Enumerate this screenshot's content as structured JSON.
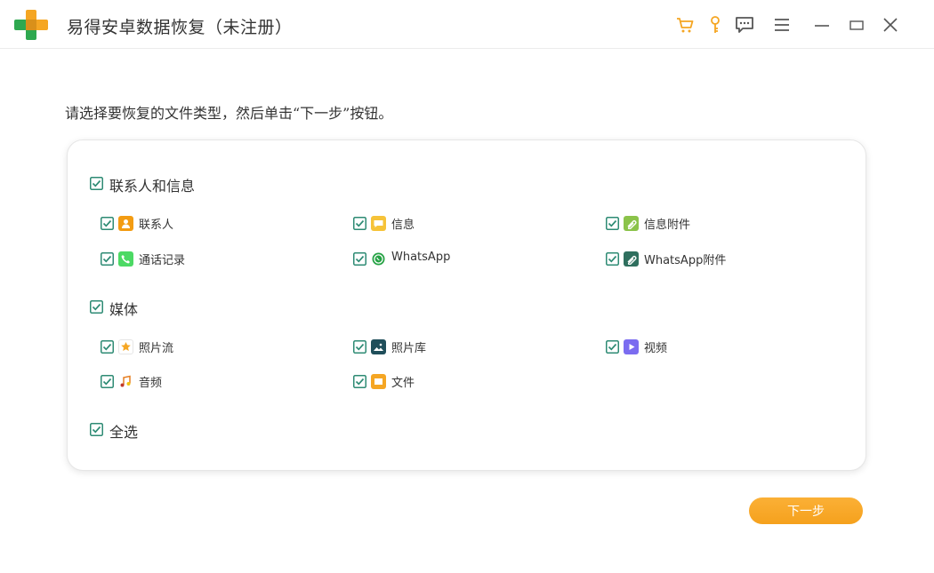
{
  "titlebar": {
    "title": "易得安卓数据恢复（未注册）",
    "icons": [
      "cart-icon",
      "key-icon",
      "feedback-icon",
      "menu-icon",
      "minimize-icon",
      "maximize-icon",
      "close-icon"
    ]
  },
  "instruction": "请选择要恢复的文件类型，然后单击“下一步”按钮。",
  "groups": [
    {
      "label": "联系人和信息",
      "checked": true,
      "items": [
        {
          "label": "联系人",
          "icon": "contacts-icon",
          "checked": true
        },
        {
          "label": "信息",
          "icon": "messages-icon",
          "checked": true
        },
        {
          "label": "信息附件",
          "icon": "attachment-icon",
          "checked": true
        },
        {
          "label": "通话记录",
          "icon": "phone-icon",
          "checked": true
        },
        {
          "label": "WhatsApp",
          "icon": "whatsapp-icon",
          "checked": true
        },
        {
          "label": "WhatsApp附件",
          "icon": "whatsapp-attachment-icon",
          "checked": true
        }
      ]
    },
    {
      "label": "媒体",
      "checked": true,
      "items": [
        {
          "label": "照片流",
          "icon": "photo-stream-icon",
          "checked": true
        },
        {
          "label": "照片库",
          "icon": "photo-library-icon",
          "checked": true
        },
        {
          "label": "视频",
          "icon": "video-icon",
          "checked": true
        },
        {
          "label": "音频",
          "icon": "audio-icon",
          "checked": true
        },
        {
          "label": "文件",
          "icon": "folder-icon",
          "checked": true
        }
      ]
    }
  ],
  "select_all": {
    "label": "全选",
    "checked": true
  },
  "next_button": "下一步",
  "colors": {
    "accent": "#f5a623",
    "checkbox": "#2e8b74",
    "title_text": "#333333"
  }
}
